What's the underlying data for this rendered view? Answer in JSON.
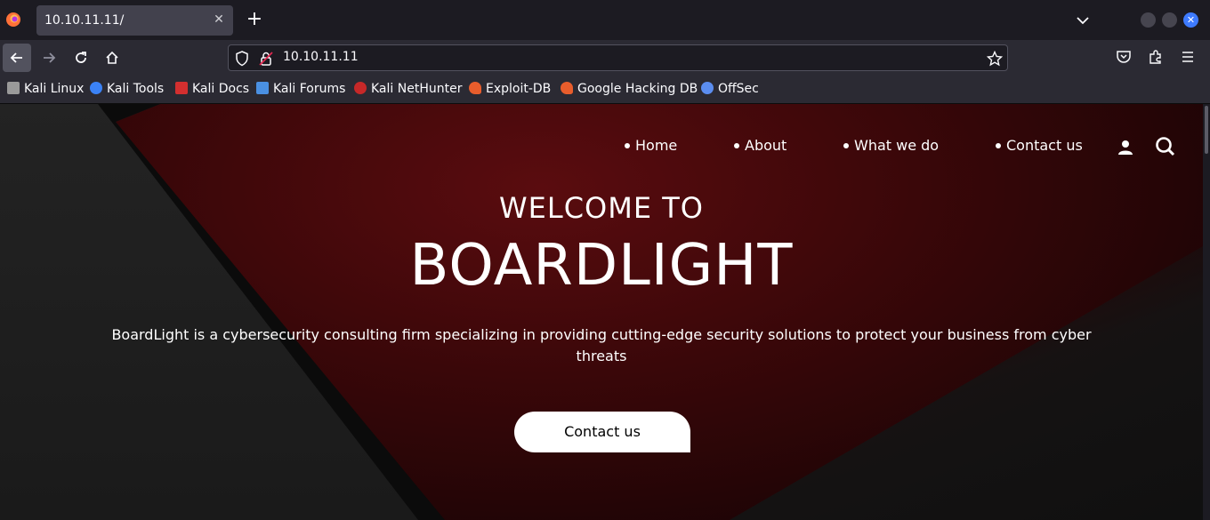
{
  "browser": {
    "tab": {
      "title": "10.10.11.11/"
    },
    "url": "10.10.11.11",
    "bookmarks": [
      {
        "label": "Kali Linux",
        "icon": "kali-dragon-icon",
        "color": "#9a9a9a"
      },
      {
        "label": "Kali Tools",
        "icon": "kali-tools-icon",
        "color": "#3b82f6"
      },
      {
        "label": "Kali Docs",
        "icon": "kali-docs-icon",
        "color": "#d32f2f"
      },
      {
        "label": "Kali Forums",
        "icon": "kali-forums-icon",
        "color": "#4a90e2"
      },
      {
        "label": "Kali NetHunter",
        "icon": "nethunter-icon",
        "color": "#c62828"
      },
      {
        "label": "Exploit-DB",
        "icon": "exploit-db-icon",
        "color": "#e85d2c"
      },
      {
        "label": "Google Hacking DB",
        "icon": "ghdb-icon",
        "color": "#e85d2c"
      },
      {
        "label": "OffSec",
        "icon": "offsec-icon",
        "color": "#5b8def"
      }
    ]
  },
  "site": {
    "nav": [
      "Home",
      "About",
      "What we do",
      "Contact us"
    ],
    "welcome": "WELCOME TO",
    "brand": "BOARDLIGHT",
    "tagline": "BoardLight is a cybersecurity consulting firm specializing in providing cutting-edge security solutions to protect your business from cyber threats",
    "cta": "Contact us"
  }
}
